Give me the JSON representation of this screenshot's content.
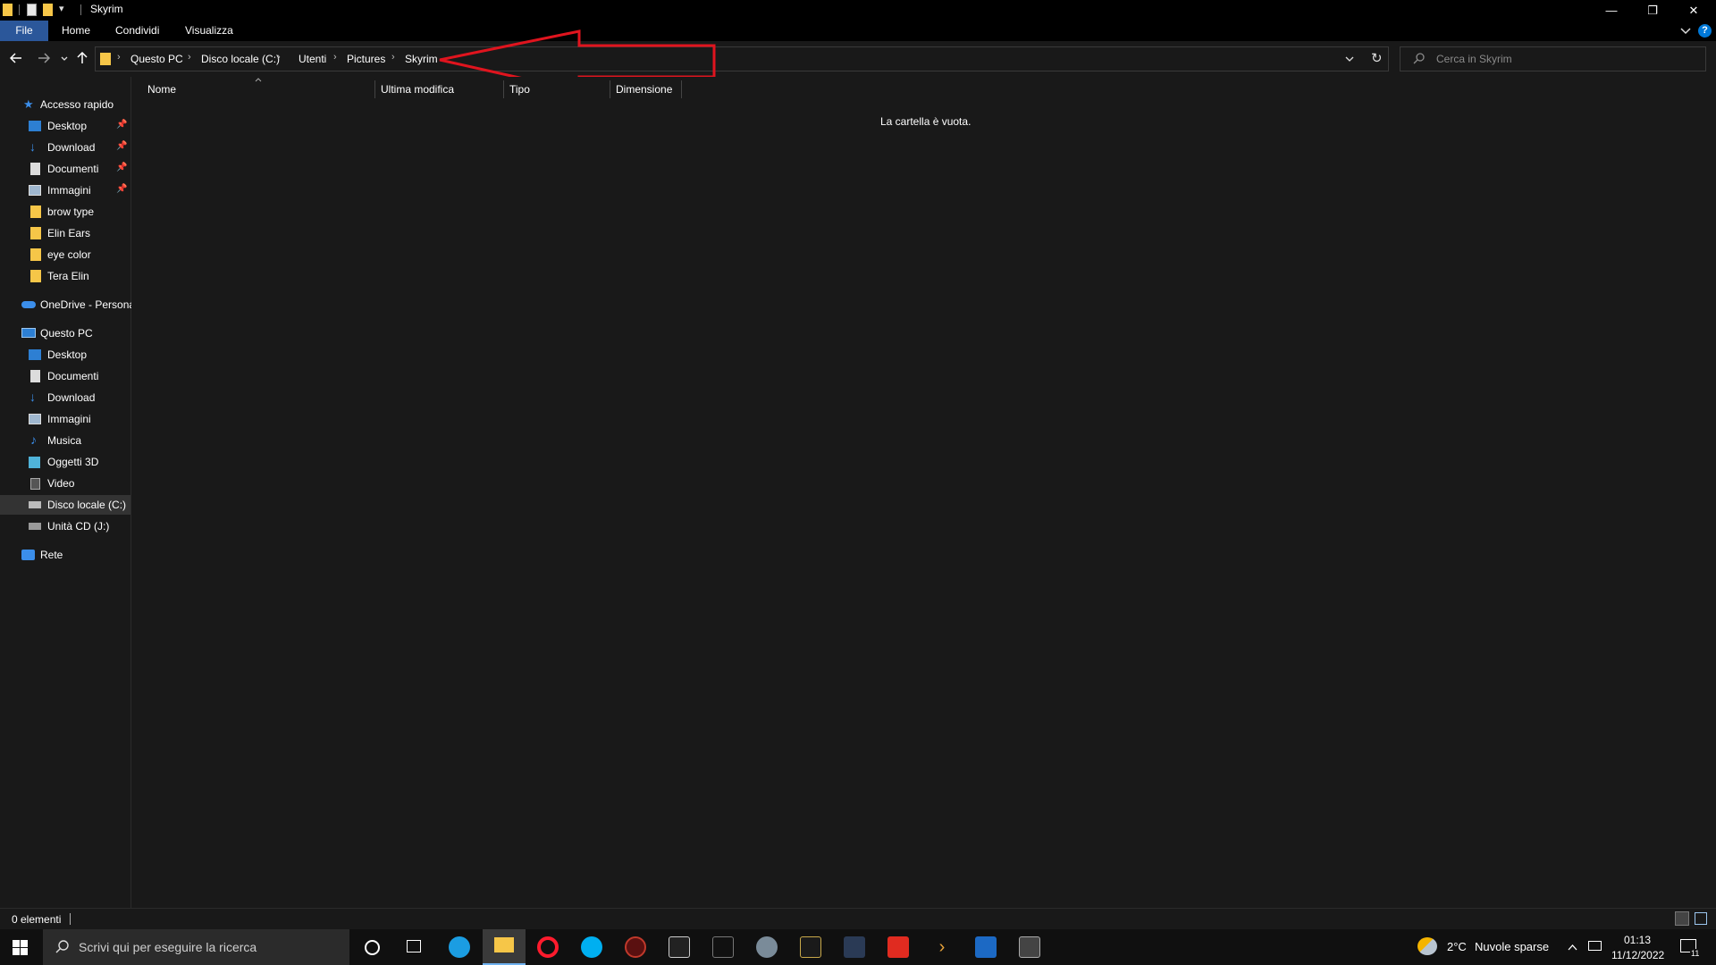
{
  "window": {
    "title": "Skyrim",
    "quick_access_arrow": "▾",
    "minimize": "—",
    "restore": "❐",
    "close": "✕"
  },
  "ribbon": {
    "tabs": [
      "File",
      "Home",
      "Condividi",
      "Visualizza"
    ],
    "collapse_icon": "chevron-down-icon",
    "help_icon": "help-icon"
  },
  "address": {
    "breadcrumbs": [
      "Questo PC",
      "Disco locale (C:)",
      "Utenti",
      "Pictures",
      "Skyrim"
    ],
    "search_placeholder": "Cerca in Skyrim"
  },
  "sidebar": {
    "quick_access": {
      "label": "Accesso rapido",
      "items": [
        {
          "label": "Desktop",
          "pinned": true,
          "icon": "desktop-icon"
        },
        {
          "label": "Download",
          "pinned": true,
          "icon": "download-icon"
        },
        {
          "label": "Documenti",
          "pinned": true,
          "icon": "documents-icon"
        },
        {
          "label": "Immagini",
          "pinned": true,
          "icon": "pictures-icon"
        },
        {
          "label": "brow type",
          "pinned": false,
          "icon": "folder-icon"
        },
        {
          "label": "Elin Ears",
          "pinned": false,
          "icon": "folder-icon"
        },
        {
          "label": "eye color",
          "pinned": false,
          "icon": "folder-icon"
        },
        {
          "label": "Tera Elin",
          "pinned": false,
          "icon": "folder-icon"
        }
      ]
    },
    "onedrive": {
      "label": "OneDrive - Persona"
    },
    "this_pc": {
      "label": "Questo PC",
      "items": [
        {
          "label": "Desktop",
          "icon": "desktop-icon"
        },
        {
          "label": "Documenti",
          "icon": "documents-icon"
        },
        {
          "label": "Download",
          "icon": "download-icon"
        },
        {
          "label": "Immagini",
          "icon": "pictures-icon"
        },
        {
          "label": "Musica",
          "icon": "music-icon"
        },
        {
          "label": "Oggetti 3D",
          "icon": "3d-objects-icon"
        },
        {
          "label": "Video",
          "icon": "video-icon"
        },
        {
          "label": "Disco locale (C:)",
          "icon": "drive-icon",
          "selected": true
        },
        {
          "label": "Unità CD (J:)",
          "icon": "cd-drive-icon"
        }
      ]
    },
    "network": {
      "label": "Rete"
    }
  },
  "content": {
    "columns": [
      "Nome",
      "Ultima modifica",
      "Tipo",
      "Dimensione"
    ],
    "empty_message": "La cartella è vuota."
  },
  "status": {
    "count": "0 elementi"
  },
  "taskbar": {
    "search_placeholder": "Scrivi qui per eseguire la ricerca",
    "weather_temp": "2°C",
    "weather_text": "Nuvole sparse",
    "time": "01:13",
    "date": "11/12/2022",
    "notification_count": "11"
  },
  "colors": {
    "background": "#191919",
    "titlebar": "#000000",
    "folder": "#f6c648",
    "accent": "#0078d7",
    "annotation_arrow": "#e0141e"
  }
}
